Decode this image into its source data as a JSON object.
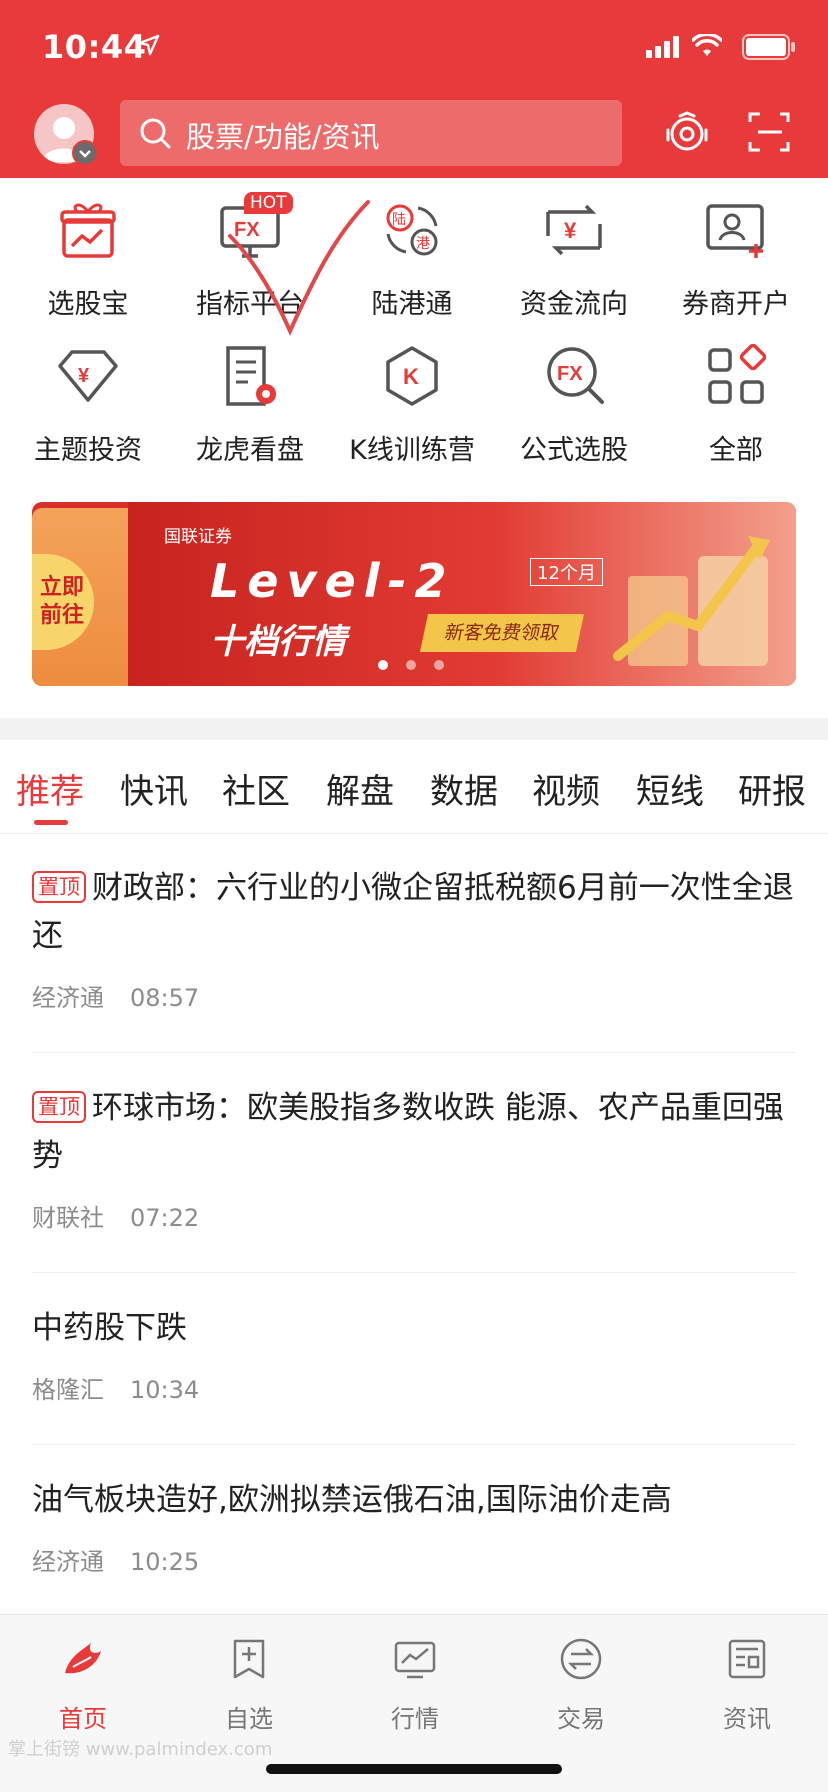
{
  "status_bar": {
    "time": "10:44"
  },
  "header": {
    "search_placeholder": "股票/功能/资讯"
  },
  "features": [
    {
      "label": "选股宝",
      "icon": "gift-chart-icon"
    },
    {
      "label": "指标平台",
      "icon": "fx-monitor-icon",
      "badge": "HOT"
    },
    {
      "label": "陆港通",
      "icon": "lu-gang-exchange-icon"
    },
    {
      "label": "资金流向",
      "icon": "yuan-exchange-icon"
    },
    {
      "label": "券商开户",
      "icon": "account-add-icon"
    },
    {
      "label": "主题投资",
      "icon": "yuan-diamond-icon"
    },
    {
      "label": "龙虎看盘",
      "icon": "document-badge-icon"
    },
    {
      "label": "K线训练营",
      "icon": "k-hexagon-icon"
    },
    {
      "label": "公式选股",
      "icon": "fx-search-icon"
    },
    {
      "label": "全部",
      "icon": "grid-all-icon"
    }
  ],
  "banner": {
    "left_cta": "立即前往",
    "logo": "国联证券",
    "headline": "Level-2",
    "months": "12个月",
    "subheadline": "十档行情",
    "cta": "新客免费领取",
    "dots": 3,
    "active_dot": 0
  },
  "tabs": [
    "推荐",
    "快讯",
    "社区",
    "解盘",
    "数据",
    "视频",
    "短线",
    "研报"
  ],
  "active_tab": "推荐",
  "news": [
    {
      "pinned": true,
      "pin_label": "置顶",
      "title": "财政部：六行业的小微企留抵税额6月前一次性全退还",
      "source": "经济通",
      "time": "08:57"
    },
    {
      "pinned": true,
      "pin_label": "置顶",
      "title": "环球市场：欧美股指多数收跌 能源、农产品重回强势",
      "source": "财联社",
      "time": "07:22"
    },
    {
      "pinned": false,
      "pin_label": "",
      "title": "中药股下跌",
      "source": "格隆汇",
      "time": "10:34"
    },
    {
      "pinned": false,
      "pin_label": "",
      "title": "油气板块造好,欧洲拟禁运俄石油,国际油价走高",
      "source": "经济通",
      "time": "10:25"
    }
  ],
  "bottom_nav": [
    {
      "label": "首页",
      "active": true,
      "icon": "home-flame-icon"
    },
    {
      "label": "自选",
      "active": false,
      "icon": "bookmark-add-icon"
    },
    {
      "label": "行情",
      "active": false,
      "icon": "chart-monitor-icon"
    },
    {
      "label": "交易",
      "active": false,
      "icon": "exchange-circle-icon"
    },
    {
      "label": "资讯",
      "active": false,
      "icon": "news-doc-icon"
    }
  ],
  "watermark": "掌上街镑 www.palmindex.com",
  "colors": {
    "brand_red": "#e83a3a",
    "text": "#222222",
    "meta": "#8c8c8c"
  }
}
